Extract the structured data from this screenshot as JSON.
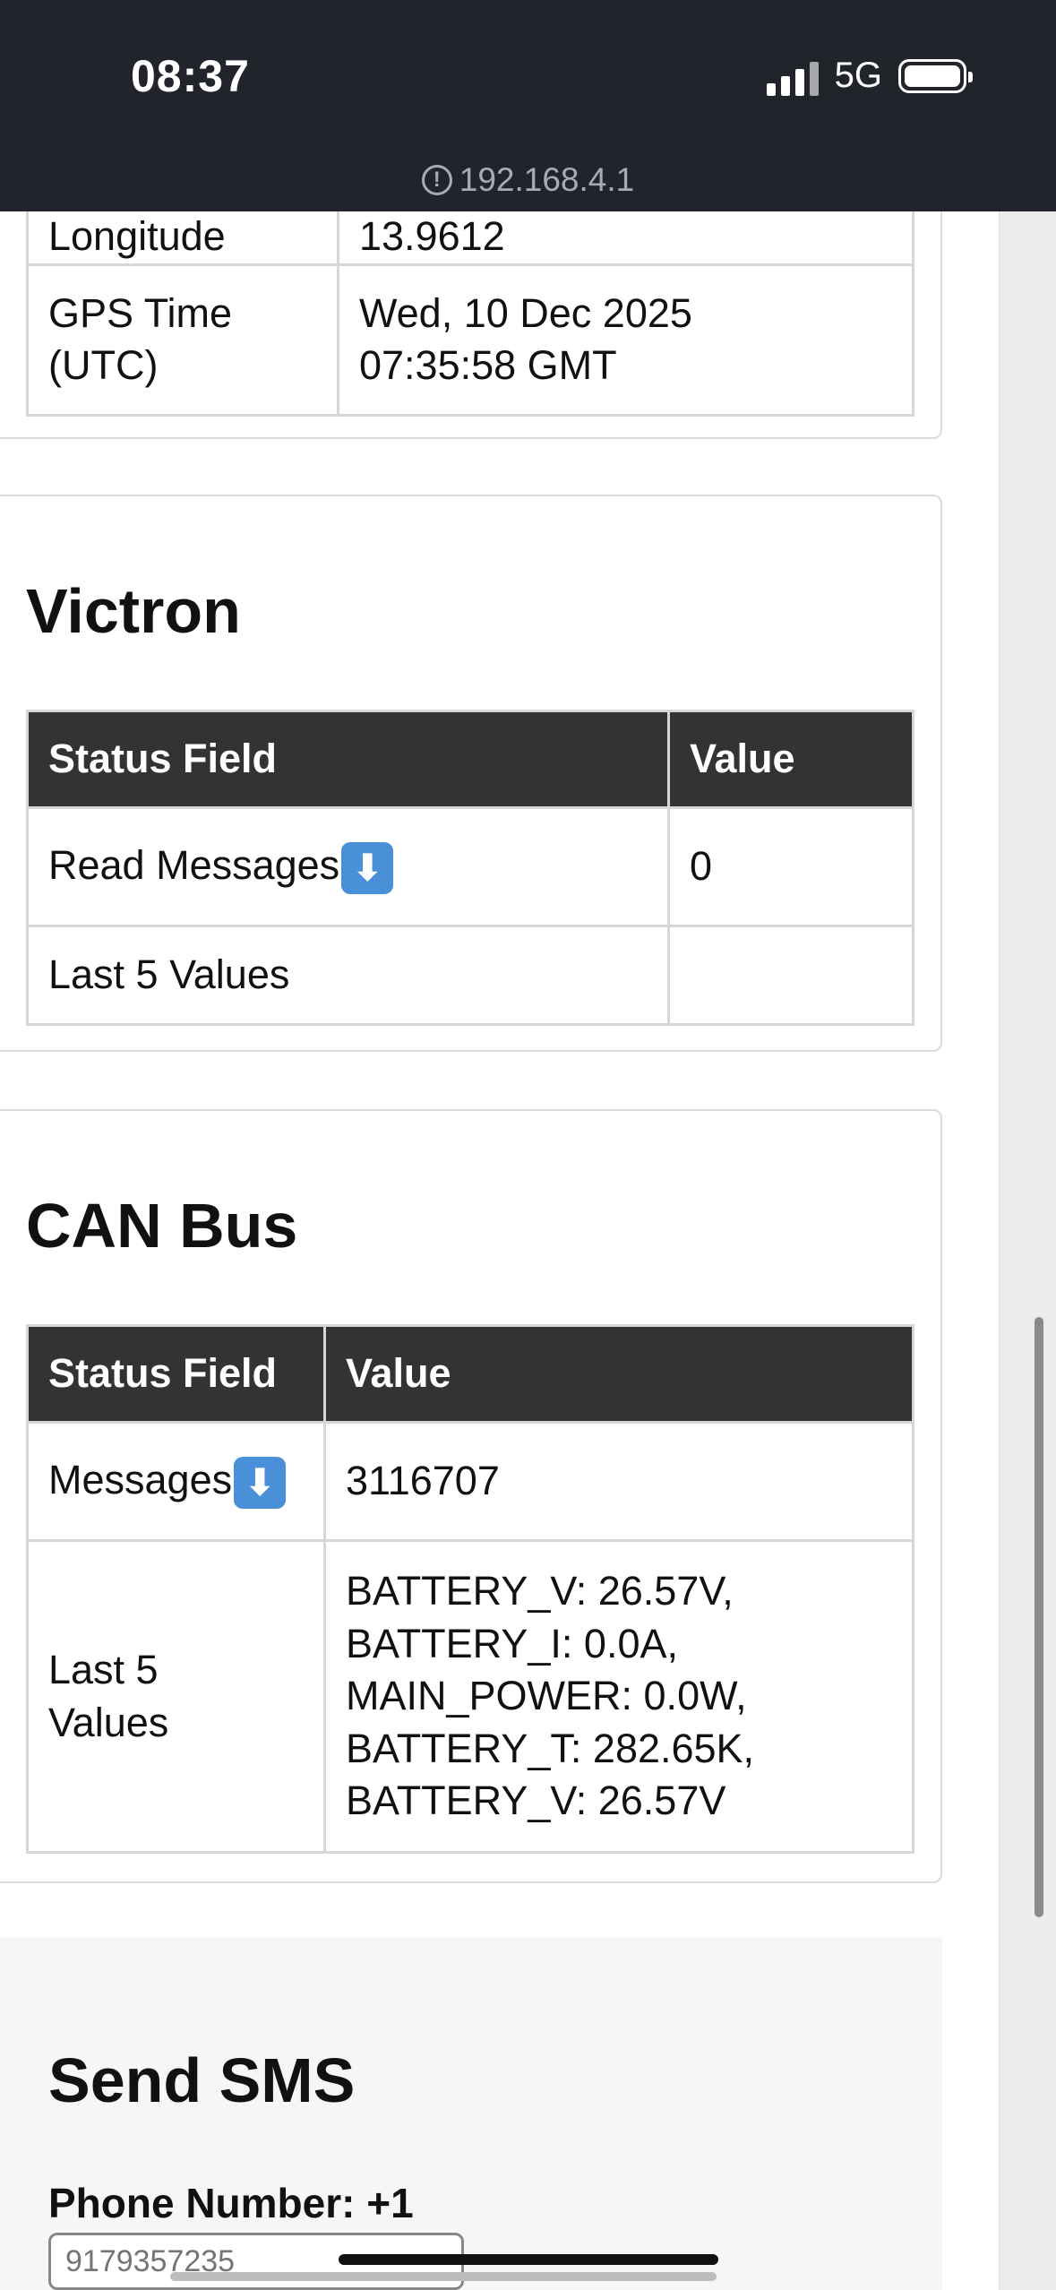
{
  "status_bar": {
    "time": "08:37",
    "network": "5G",
    "url": "192.168.4.1"
  },
  "gps_table": {
    "rows": [
      {
        "field": "Longitude",
        "value": "13.9612"
      },
      {
        "field_line1": "GPS Time",
        "field_line2": "(UTC)",
        "value_line1": "Wed, 10 Dec 2025",
        "value_line2": "07:35:58 GMT"
      }
    ]
  },
  "victron": {
    "title": "Victron",
    "headers": [
      "Status Field",
      "Value"
    ],
    "rows": [
      {
        "field": "Read Messages",
        "icon": "down-arrow-icon",
        "value": "0"
      },
      {
        "field": "Last 5 Values",
        "value": ""
      }
    ]
  },
  "can_bus": {
    "title": "CAN Bus",
    "headers": [
      "Status Field",
      "Value"
    ],
    "rows": [
      {
        "field": "Messages",
        "icon": "down-arrow-icon",
        "value": "3116707"
      },
      {
        "field_line1": "Last 5",
        "field_line2": "Values",
        "values": [
          "BATTERY_V: 26.57V,",
          "BATTERY_I: 0.0A,",
          "MAIN_POWER: 0.0W,",
          "BATTERY_T: 282.65K,",
          "BATTERY_V: 26.57V"
        ]
      }
    ]
  },
  "sms": {
    "title": "Send SMS",
    "phone_label": "Phone Number: +1",
    "phone_value": "9179357235"
  },
  "colors": {
    "header_bg": "#333333",
    "status_bar_bg": "#22242b",
    "emoji_blue": "#4a90d9"
  }
}
